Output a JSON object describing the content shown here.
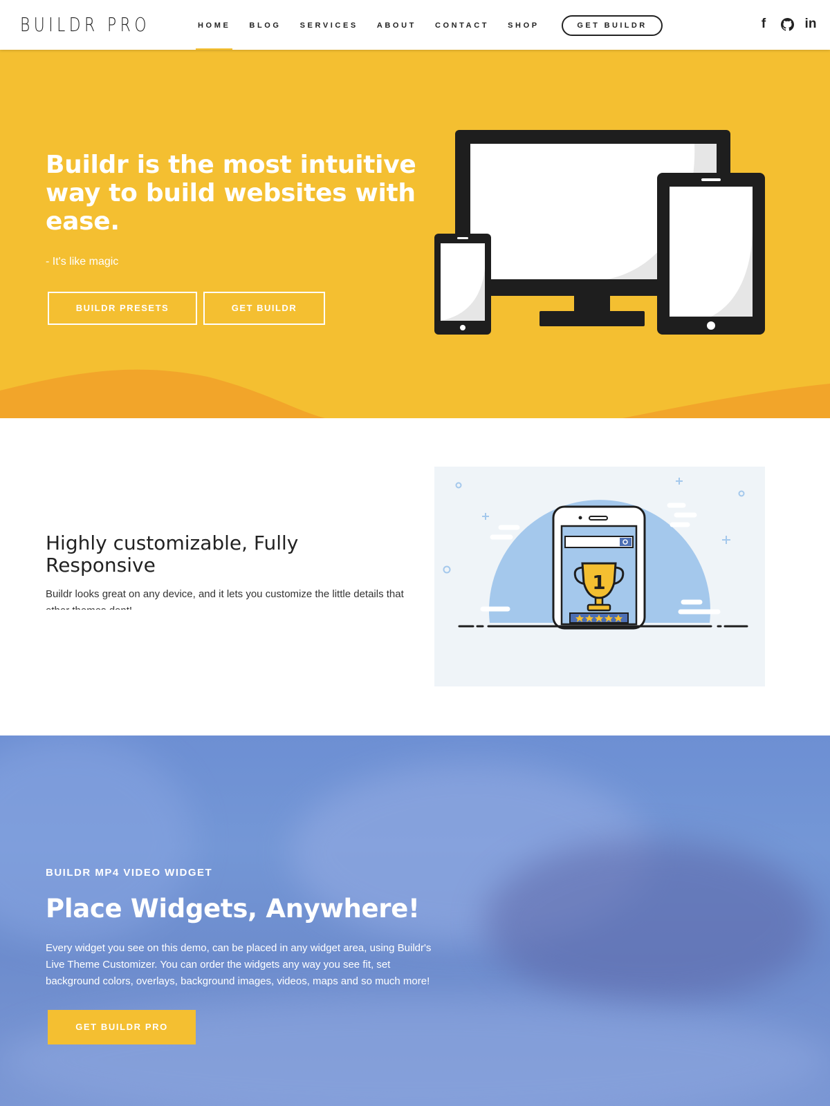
{
  "header": {
    "logo": "BUILDR PRO",
    "nav": [
      "HOME",
      "BLOG",
      "SERVICES",
      "ABOUT",
      "CONTACT",
      "SHOP"
    ],
    "cta": "GET BUILDR",
    "socials": [
      {
        "icon": "facebook-icon",
        "glyph": "f"
      },
      {
        "icon": "github-icon",
        "glyph": "◉"
      },
      {
        "icon": "linkedin-icon",
        "glyph": "in"
      }
    ]
  },
  "hero": {
    "title": "Buildr is the most intuitive way to build websites with ease.",
    "tagline": "- It's like magic",
    "primary_button": "BUILDR PRESETS",
    "secondary_button": "GET BUILDR",
    "illustration_icon": "devices-icon",
    "illustration_colors": {
      "device": "#1e1e1e",
      "screen": "#ffffff",
      "shade": "#e6e6e6"
    }
  },
  "feature": {
    "title": "Highly customizable, Fully Responsive",
    "text": "Buildr looks great on any device, and it lets you customize the little details that other themes dont!",
    "illustration_icon": "trophy-phone-icon",
    "illustration_badge": "1"
  },
  "video": {
    "label": "BUILDR MP4 VIDEO WIDGET",
    "title": "Place Widgets, Anywhere!",
    "text": "Every widget you see on this demo, can be placed in any widget area, using Buildr's Live Theme Customizer. You can order the widgets any way you see fit, set background colors, overlays, background images, videos, maps and so much more!",
    "button": "GET BUILDR PRO"
  },
  "colors": {
    "accent": "#f4bf31",
    "accent_dark": "#f2a52a",
    "text_dark": "#222222",
    "video_overlay": "#6d8fd3",
    "illustration_bg": "#eff4f8",
    "illustration_circle": "#a4c8ec"
  }
}
